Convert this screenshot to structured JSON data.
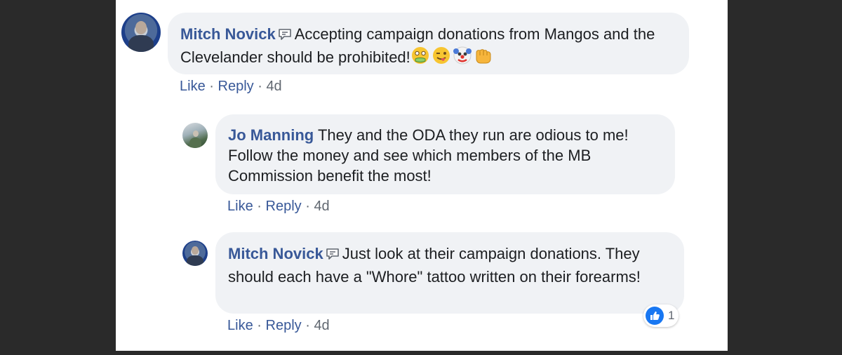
{
  "comments": [
    {
      "author": "Mitch Novick",
      "text": "Accepting campaign donations from Mangos and the Clevelander should be prohibited!",
      "actions": {
        "like": "Like",
        "reply": "Reply",
        "time": "4d",
        "sep": "·"
      }
    },
    {
      "author": "Jo Manning",
      "text": "They and the ODA they run are odious to me! Follow the money and see which members of the MB Commission benefit the most!",
      "actions": {
        "like": "Like",
        "reply": "Reply",
        "time": "4d",
        "sep": "·"
      }
    },
    {
      "author": "Mitch Novick",
      "text": "Just look at their campaign donations. They should each have a \"Whore\" tattoo written on their forearms!",
      "actions": {
        "like": "Like",
        "reply": "Reply",
        "time": "4d",
        "sep": "·"
      },
      "reaction_count": "1"
    }
  ],
  "emojis": [
    "nauseated-face",
    "winking-tongue-face",
    "clown-face",
    "fist-bump"
  ],
  "colors": {
    "author": "#385898",
    "bubble": "#f0f2f5",
    "like_blue": "#1877f2"
  }
}
